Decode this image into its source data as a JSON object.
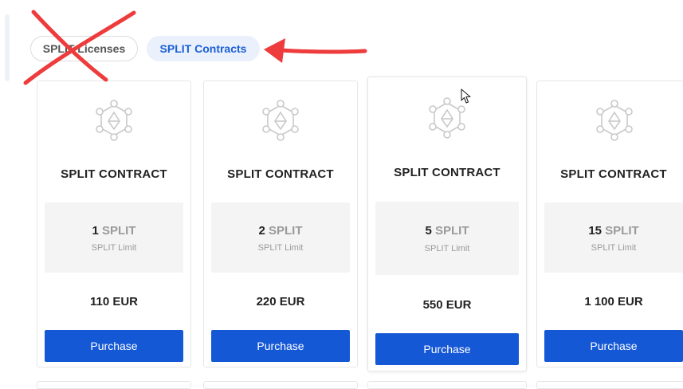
{
  "tabs": {
    "licenses_label": "SPLIT Licenses",
    "contracts_label": "SPLIT Contracts",
    "active": "SPLIT Contracts"
  },
  "cards": [
    {
      "title": "SPLIT CONTRACT",
      "limit_number": "1",
      "limit_unit": "SPLIT",
      "limit_label": "SPLIT Limit",
      "price": "110 EUR",
      "button": "Purchase"
    },
    {
      "title": "SPLIT CONTRACT",
      "limit_number": "2",
      "limit_unit": "SPLIT",
      "limit_label": "SPLIT Limit",
      "price": "220 EUR",
      "button": "Purchase"
    },
    {
      "title": "SPLIT CONTRACT",
      "limit_number": "5",
      "limit_unit": "SPLIT",
      "limit_label": "SPLIT Limit",
      "price": "550 EUR",
      "button": "Purchase"
    },
    {
      "title": "SPLIT CONTRACT",
      "limit_number": "15",
      "limit_unit": "SPLIT",
      "limit_label": "SPLIT Limit",
      "price": "1 100 EUR",
      "button": "Purchase"
    }
  ],
  "colors": {
    "primary_button": "#1558d6",
    "active_tab_bg": "#eaf1fc",
    "active_tab_text": "#1b5fd6",
    "annotation_red": "#ee3b3b"
  },
  "icons": {
    "card_logo": "ethereum-network-icon",
    "annotation_cross": "red-x-annotation",
    "annotation_arrow": "red-arrow-annotation",
    "cursor": "mouse-pointer-icon"
  }
}
